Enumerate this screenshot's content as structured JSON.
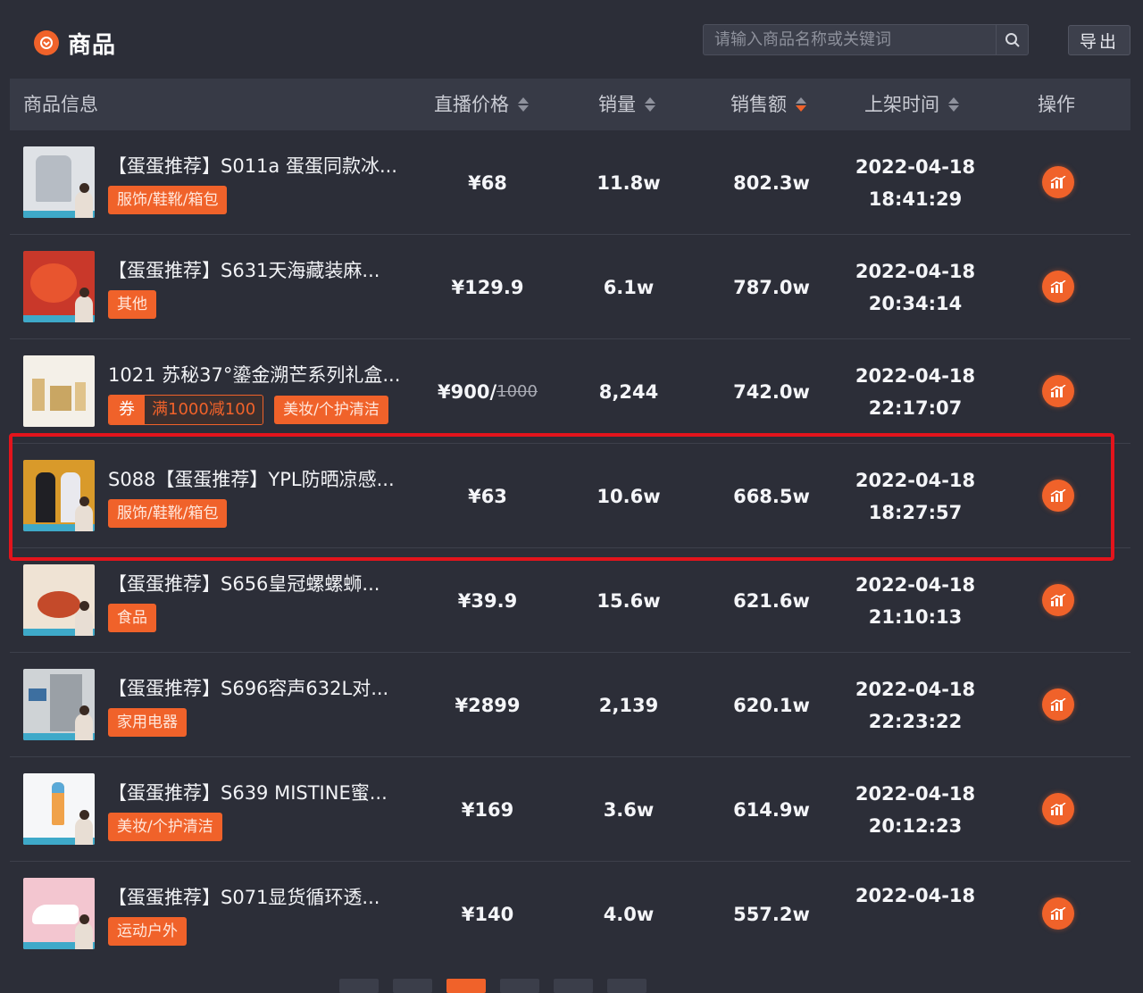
{
  "header": {
    "title": "商品",
    "search_placeholder": "请输入商品名称或关键词",
    "export_label": "导出"
  },
  "columns": {
    "info": "商品信息",
    "price": "直播价格",
    "sales": "销量",
    "revenue": "销售额",
    "time": "上架时间",
    "action": "操作"
  },
  "rows": [
    {
      "name": "【蛋蛋推荐】S011a 蛋蛋同款冰...",
      "tag": "服饰/鞋靴/箱包",
      "price": "¥68",
      "orig_price": "",
      "sales": "11.8w",
      "revenue": "802.3w",
      "date": "2022-04-18",
      "time": "18:41:29"
    },
    {
      "name": "【蛋蛋推荐】S631天海藏装麻...",
      "tag": "其他",
      "price": "¥129.9",
      "orig_price": "",
      "sales": "6.1w",
      "revenue": "787.0w",
      "date": "2022-04-18",
      "time": "20:34:14"
    },
    {
      "name": "1021 苏秘37°鎏金溯芒系列礼盒...",
      "tag": "美妆/个护清洁",
      "coupon_key": "券",
      "coupon_value": "满1000减100",
      "price": "¥900/",
      "orig_price": "1000",
      "sales": "8,244",
      "revenue": "742.0w",
      "date": "2022-04-18",
      "time": "22:17:07"
    },
    {
      "name": "S088【蛋蛋推荐】YPL防晒凉感...",
      "tag": "服饰/鞋靴/箱包",
      "price": "¥63",
      "orig_price": "",
      "sales": "10.6w",
      "revenue": "668.5w",
      "date": "2022-04-18",
      "time": "18:27:57"
    },
    {
      "name": "【蛋蛋推荐】S656皇冠螺螺蛳...",
      "tag": "食品",
      "price": "¥39.9",
      "orig_price": "",
      "sales": "15.6w",
      "revenue": "621.6w",
      "date": "2022-04-18",
      "time": "21:10:13"
    },
    {
      "name": "【蛋蛋推荐】S696容声632L对...",
      "tag": "家用电器",
      "price": "¥2899",
      "orig_price": "",
      "sales": "2,139",
      "revenue": "620.1w",
      "date": "2022-04-18",
      "time": "22:23:22"
    },
    {
      "name": "【蛋蛋推荐】S639 MISTINE蜜...",
      "tag": "美妆/个护清洁",
      "price": "¥169",
      "orig_price": "",
      "sales": "3.6w",
      "revenue": "614.9w",
      "date": "2022-04-18",
      "time": "20:12:23"
    },
    {
      "name": "【蛋蛋推荐】S071显货循环透...",
      "tag": "运动户外",
      "price": "¥140",
      "orig_price": "",
      "sales": "4.0w",
      "revenue": "557.2w",
      "date": "2022-04-18",
      "time": ""
    }
  ],
  "colors": {
    "background": "#2c2e38",
    "accent": "#f0622a",
    "highlight": "#e3141c"
  },
  "icons": [
    "brand-logo-icon",
    "search-icon",
    "chart-icon",
    "sort-icon"
  ]
}
